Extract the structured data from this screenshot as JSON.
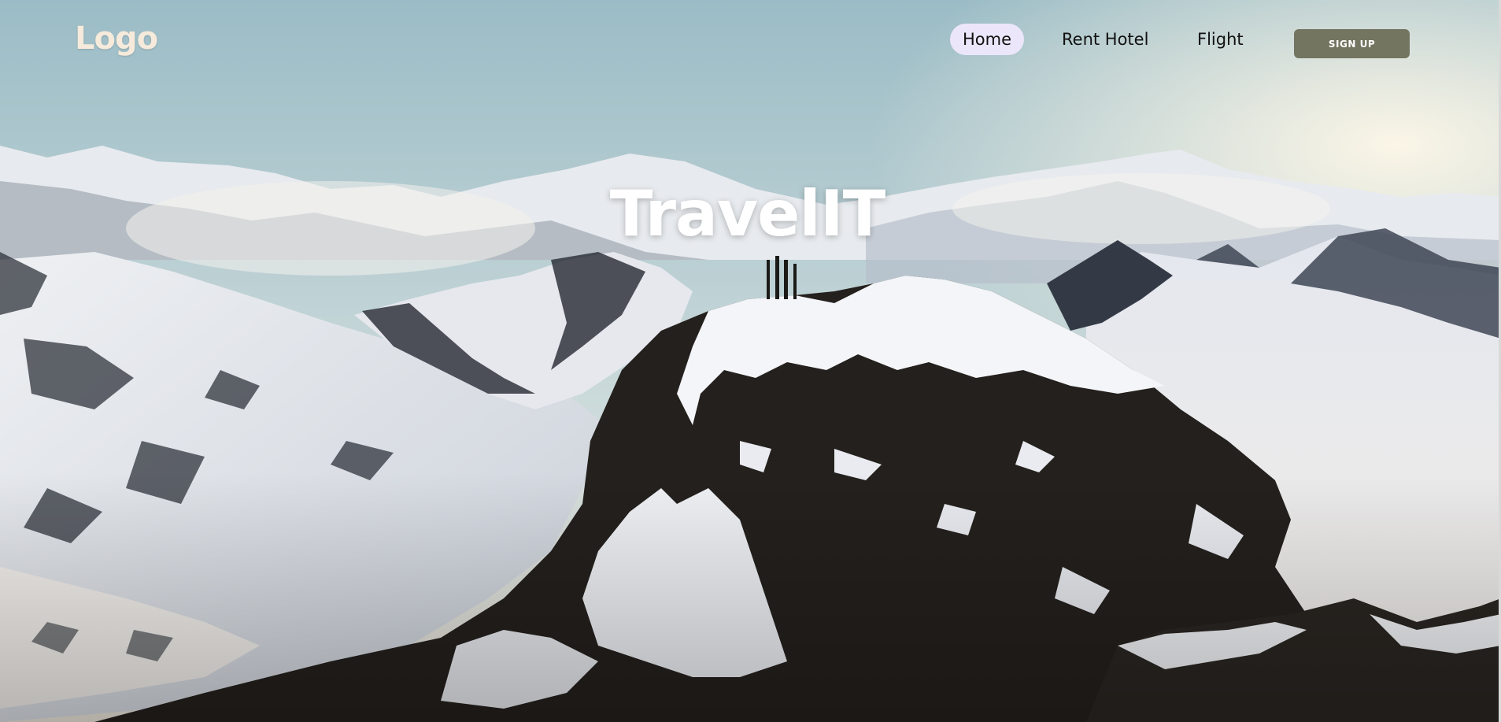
{
  "header": {
    "logo": "Logo",
    "nav": [
      {
        "label": "Home",
        "active": true
      },
      {
        "label": "Rent Hotel",
        "active": false
      },
      {
        "label": "Flight",
        "active": false
      }
    ],
    "signup_label": "SIGN UP"
  },
  "hero": {
    "title": "TravelIT",
    "background": "snowy-mountain-peak-photo"
  },
  "colors": {
    "accent_button": "#737560",
    "active_nav_bg": "#ece6fb",
    "logo_text": "#f5eadb",
    "sky_top": "#9fbfc8",
    "sky_bottom": "#f6f1e7"
  }
}
